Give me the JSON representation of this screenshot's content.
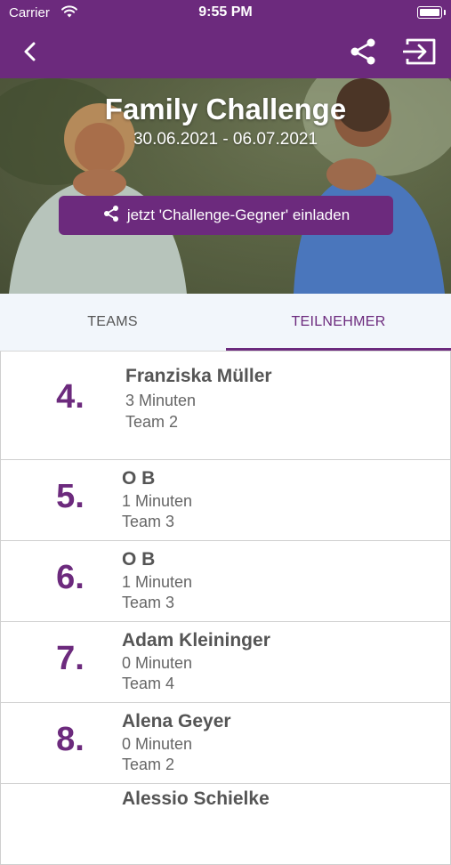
{
  "statusbar": {
    "carrier": "Carrier",
    "time": "9:55 PM"
  },
  "hero": {
    "title": "Family Challenge",
    "dates": "30.06.2021 - 06.07.2021",
    "invite_label": "jetzt 'Challenge-Gegner' einladen"
  },
  "tabs": [
    {
      "label": "TEAMS",
      "selected": false
    },
    {
      "label": "TEILNEHMER",
      "selected": true
    }
  ],
  "participants": [
    {
      "rank": "4.",
      "name": "Franziska Müller",
      "minutes": "3 Minuten",
      "team": "Team 2"
    },
    {
      "rank": "5.",
      "name": "O B",
      "minutes": "1 Minuten",
      "team": "Team 3"
    },
    {
      "rank": "6.",
      "name": "O B",
      "minutes": "1 Minuten",
      "team": "Team 3"
    },
    {
      "rank": "7.",
      "name": "Adam Kleininger",
      "minutes": "0 Minuten",
      "team": "Team 4"
    },
    {
      "rank": "8.",
      "name": "Alena Geyer",
      "minutes": "0 Minuten",
      "team": "Team 2"
    },
    {
      "rank": "",
      "name": "Alessio Schielke",
      "minutes": "",
      "team": ""
    }
  ],
  "colors": {
    "brand": "#6c2a7d",
    "tab_bg": "#f2f6fb"
  },
  "icons": [
    "back-icon",
    "share-icon",
    "exit-icon",
    "share-small-icon",
    "wifi-icon",
    "battery-icon"
  ]
}
